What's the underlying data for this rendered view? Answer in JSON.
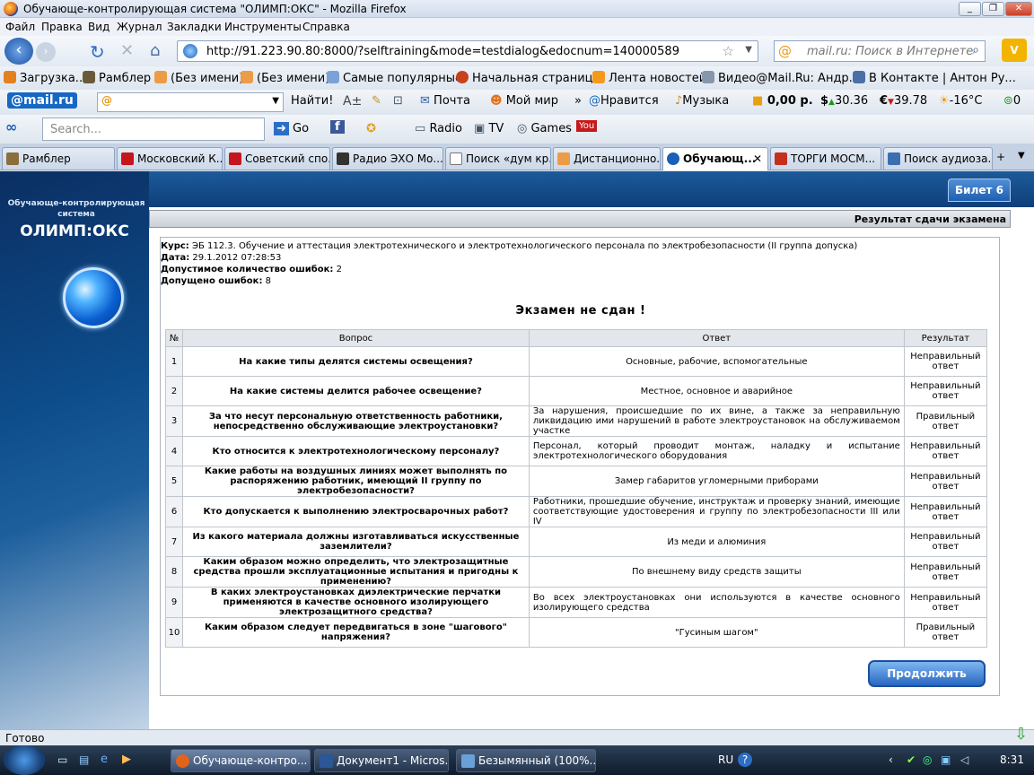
{
  "window": {
    "title": "Обучающе-контролирующая система \"ОЛИМП:ОКС\" - Mozilla Firefox"
  },
  "menu": [
    "Файл",
    "Правка",
    "Вид",
    "Журнал",
    "Закладки",
    "Инструменты",
    "Справка"
  ],
  "nav": {
    "url": "http://91.223.90.80:8000/?selftraining&mode=testdialog&edocnum=140000589",
    "search_placeholder": "mail.ru: Поиск в Интернете"
  },
  "bookmarks": [
    "Загрузка...",
    "Рамблер",
    "(Без имени)",
    "(Без имени)",
    "Самые популярные",
    "Начальная страница",
    "Лента новостей",
    "Видео@Mail.Ru: Андр...",
    "В Контакте | Антон Ру..."
  ],
  "mailbar": {
    "logo": "@mail.ru",
    "find": "Найти!",
    "pochta": "Почта",
    "moimir": "Мой мир",
    "nravitsya": "Нравится",
    "muzyka": "Музыка",
    "balance": "0,00 р.",
    "usd": "30.36",
    "eur": "39.78",
    "temp": "-16°C",
    "count": "0"
  },
  "searchbar": {
    "placeholder": "Search...",
    "go": "Go",
    "radio": "Radio",
    "tv": "TV",
    "games": "Games"
  },
  "tabs": [
    "Рамблер",
    "Московский К...",
    "Советский спо...",
    "Радио ЭХО Мо...",
    "Поиск «дум кр...",
    "Дистанционно...",
    "Обучающ...",
    "ТОРГИ МОСМ...",
    "Поиск аудиоза..."
  ],
  "active_tab_index": 6,
  "app": {
    "system_name": "Обучающе-контролирующая система",
    "brand": "ОЛИМП:ОКС",
    "ticket": "Билет 6",
    "result_header": "Результат сдачи экзамена",
    "course_label": "Курс:",
    "course": "ЭБ 112.3. Обучение и аттестация электротехнического и электротехнологического персонала по электробезопасности (II группа допуска)",
    "date_label": "Дата:",
    "date": "29.1.2012 07:28:53",
    "allowed_label": "Допустимое количество ошибок:",
    "allowed": "2",
    "made_label": "Допущено ошибок:",
    "made": "8",
    "verdict": "Экзамен не сдан !",
    "columns": [
      "№",
      "Вопрос",
      "Ответ",
      "Результат"
    ],
    "rows": [
      {
        "n": "1",
        "q": "На какие типы делятся системы освещения?",
        "a": "Основные, рабочие, вспомогательные",
        "r": "Неправильный ответ",
        "long": false
      },
      {
        "n": "2",
        "q": "На какие системы делится рабочее освещение?",
        "a": "Местное, основное и аварийное",
        "r": "Неправильный ответ",
        "long": false
      },
      {
        "n": "3",
        "q": "За что несут персональную ответственность работники, непосредственно обслуживающие электроустановки?",
        "a": "За нарушения, происшедшие по их вине, а также за неправильную ликвидацию ими нарушений в работе электроустановок на обслуживаемом участке",
        "r": "Правильный ответ",
        "long": true
      },
      {
        "n": "4",
        "q": "Кто относится к электротехнологическому персоналу?",
        "a": "Персонал, который проводит монтаж, наладку и испытание электротехнологического оборудования",
        "r": "Неправильный ответ",
        "long": true
      },
      {
        "n": "5",
        "q": "Какие работы на воздушных линиях может выполнять по распоряжению работник, имеющий II группу по электробезопасности?",
        "a": "Замер габаритов угломерными приборами",
        "r": "Неправильный ответ",
        "long": false
      },
      {
        "n": "6",
        "q": "Кто допускается к выполнению электросварочных работ?",
        "a": "Работники, прошедшие обучение, инструктаж и проверку знаний, имеющие соответствующие удостоверения и группу по электробезопасности III или IV",
        "r": "Неправильный ответ",
        "long": true
      },
      {
        "n": "7",
        "q": "Из какого материала должны изготавливаться искусственные заземлители?",
        "a": "Из меди и алюминия",
        "r": "Неправильный ответ",
        "long": false
      },
      {
        "n": "8",
        "q": "Каким образом можно определить, что электрозащитные средства прошли эксплуатационные испытания и пригодны к применению?",
        "a": "По внешнему виду средств защиты",
        "r": "Неправильный ответ",
        "long": false
      },
      {
        "n": "9",
        "q": "В каких электроустановках диэлектрические перчатки применяются в качестве основного изолирующего электрозащитного средства?",
        "a": "Во всех электроустановках они используются в качестве основного изолирующего средства",
        "r": "Неправильный ответ",
        "long": true
      },
      {
        "n": "10",
        "q": "Каким образом следует передвигаться в зоне \"шагового\" напряжения?",
        "a": "\"Гусиным шагом\"",
        "r": "Правильный ответ",
        "long": false
      }
    ],
    "continue": "Продолжить"
  },
  "status": "Готово",
  "taskbar": {
    "items": [
      "Обучающе-контро...",
      "Документ1 - Micros...",
      "Безымянный (100%..."
    ],
    "lang": "RU",
    "time": "8:31"
  }
}
